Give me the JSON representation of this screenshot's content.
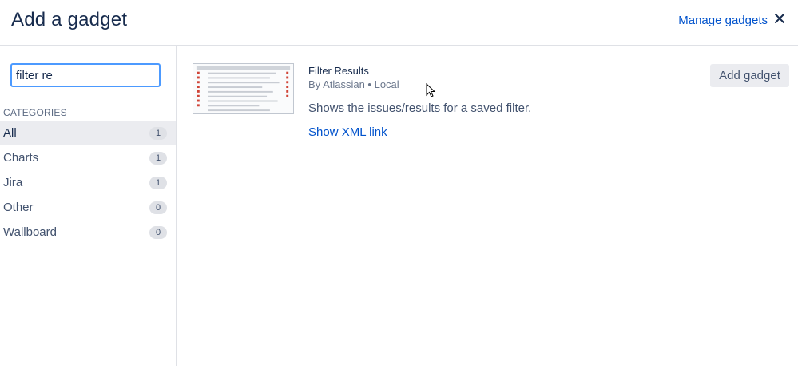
{
  "header": {
    "title": "Add a gadget",
    "manage_link": "Manage gadgets",
    "close_icon": "close-icon"
  },
  "sidebar": {
    "search": {
      "value": "filter re",
      "placeholder": ""
    },
    "categories_heading": "CATEGORIES",
    "categories": [
      {
        "label": "All",
        "count": "1",
        "selected": true
      },
      {
        "label": "Charts",
        "count": "1",
        "selected": false
      },
      {
        "label": "Jira",
        "count": "1",
        "selected": false
      },
      {
        "label": "Other",
        "count": "0",
        "selected": false
      },
      {
        "label": "Wallboard",
        "count": "0",
        "selected": false
      }
    ]
  },
  "gadget": {
    "title": "Filter Results",
    "author": "By Atlassian • Local",
    "description": "Shows the issues/results for a saved filter.",
    "xml_link": "Show XML link",
    "thumbnail_icon": "filter-results-thumbnail",
    "add_button": "Add gadget"
  },
  "colors": {
    "link": "#0052cc",
    "focus_border": "#4c9aff",
    "selected_bg": "#ebecf0",
    "text_dark": "#172b4d",
    "text_muted": "#6b778c"
  }
}
